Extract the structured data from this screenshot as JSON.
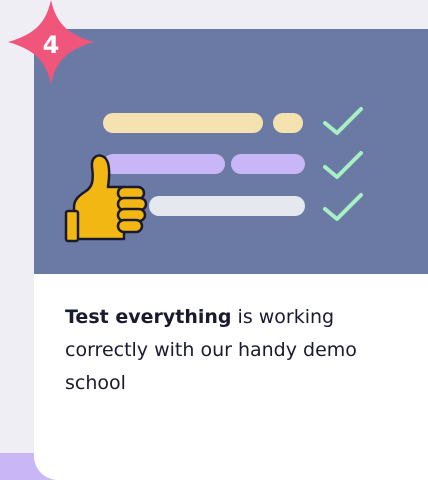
{
  "step": {
    "number": "4"
  },
  "card": {
    "text_strong": "Test everything",
    "text_rest": " is working correctly with our handy demo school"
  },
  "icons": [
    "sparkle-star-icon",
    "thumbs-up-icon",
    "checkmark-icon"
  ],
  "colors": {
    "page_bg": "#eeeef4",
    "illustration_bg": "#6a7aa5",
    "badge": "#f0557c",
    "line_yellow": "#f4e2b0",
    "line_purple": "#c9b6f7",
    "line_gray": "#e6e8f0",
    "check": "#a6f0c4",
    "thumb": "#f2b712",
    "strip": "#c9b6f7"
  }
}
